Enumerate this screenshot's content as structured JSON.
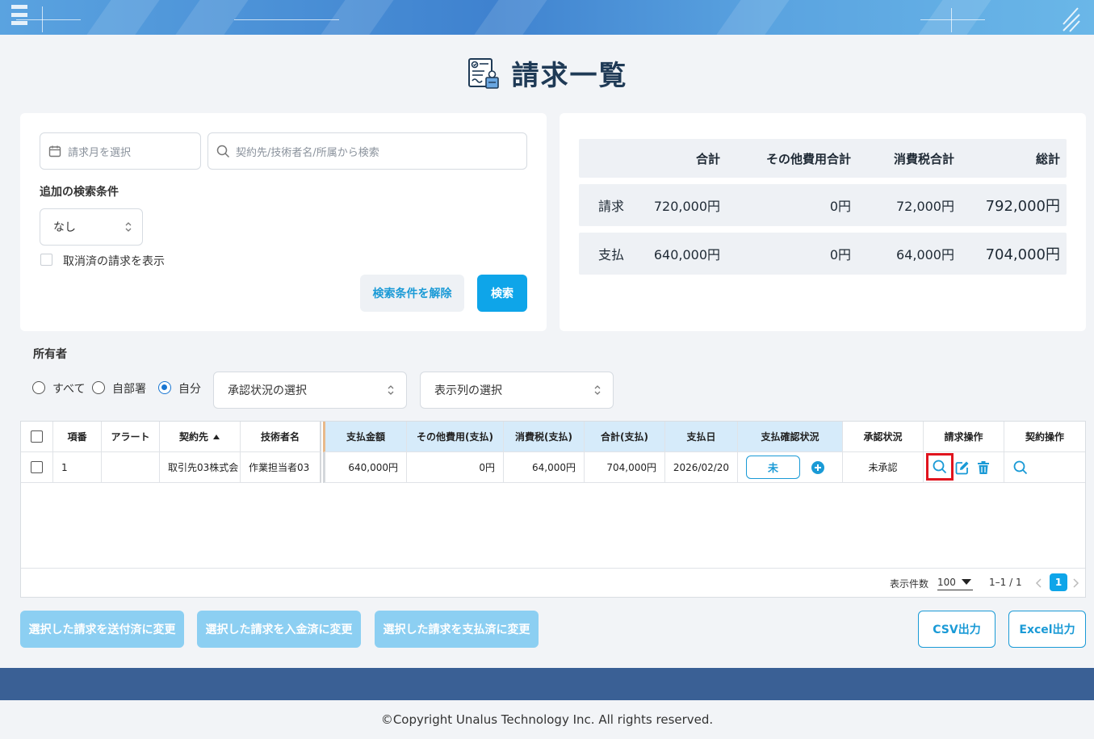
{
  "page": {
    "title": "請求一覧"
  },
  "search": {
    "month_placeholder": "請求月を選択",
    "keyword_placeholder": "契約先/技術者名/所属から検索",
    "extra_label": "追加の検索条件",
    "extra_value": "なし",
    "show_cancelled_label": "取消済の請求を表示",
    "clear_label": "検索条件を解除",
    "search_label": "検索"
  },
  "summary": {
    "headers": [
      "合計",
      "その他費用合計",
      "消費税合計",
      "総計"
    ],
    "rows": [
      {
        "label": "請求",
        "total": "720,000円",
        "other": "0円",
        "tax": "72,000円",
        "grand": "792,000円"
      },
      {
        "label": "支払",
        "total": "640,000円",
        "other": "0円",
        "tax": "64,000円",
        "grand": "704,000円"
      }
    ]
  },
  "owner": {
    "label": "所有者",
    "options": [
      "すべて",
      "自部署",
      "自分"
    ],
    "selected": "自分",
    "approval_select": "承認状況の選択",
    "columns_select": "表示列の選択"
  },
  "table": {
    "headers": {
      "no": "項番",
      "alert": "アラート",
      "client": "契約先",
      "engineer": "技術者名",
      "pay_amount": "支払金額",
      "other_pay": "その他費用(支払)",
      "tax_pay": "消費税(支払)",
      "total_pay": "合計(支払)",
      "pay_date": "支払日",
      "pay_status": "支払確認状況",
      "approval": "承認状況",
      "invoice_ops": "請求操作",
      "contract_ops": "契約操作"
    },
    "rows": [
      {
        "no": "1",
        "alert": "",
        "client": "取引先03株式会",
        "engineer": "作業担当者03",
        "pay_amount": "640,000円",
        "other_pay": "0円",
        "tax_pay": "64,000円",
        "total_pay": "704,000円",
        "pay_date": "2026/02/20",
        "pay_status": "未",
        "approval": "未承認"
      }
    ],
    "pagination": {
      "per_page_label": "表示件数",
      "per_page": "100",
      "range": "1–1 / 1",
      "current_page": "1"
    }
  },
  "actions": {
    "mark_sent": "選択した請求を送付済に変更",
    "mark_received": "選択した請求を入金済に変更",
    "mark_paid": "選択した請求を支払済に変更",
    "csv": "CSV出力",
    "excel": "Excel出力"
  },
  "footer": {
    "copyright": "©Copyright Unalus Technology Inc. All rights reserved."
  },
  "colors": {
    "accent": "#0ea5e9",
    "title": "#1f3a56",
    "header_blue": "#d6ebfa",
    "footer_band": "#3a6095",
    "highlight": "#e0141e"
  },
  "icons": [
    "menu-icon",
    "invoice-doc-icon",
    "calendar-icon",
    "search-icon",
    "select-arrows-icon",
    "sort-up-icon",
    "plus-circle-icon",
    "edit-icon",
    "trash-icon",
    "chevron-left-icon",
    "chevron-right-icon",
    "dropdown-caret-icon"
  ]
}
